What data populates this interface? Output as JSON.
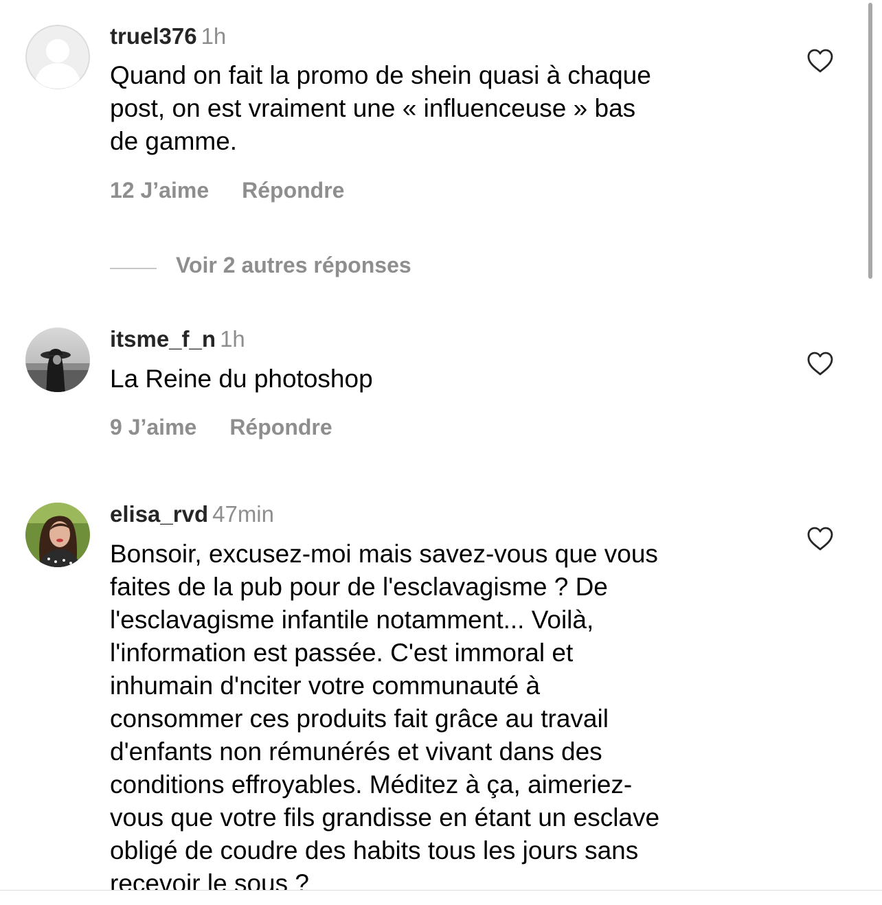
{
  "comments": [
    {
      "username": "truel376",
      "time": "1h",
      "avatar": "default-avatar-icon",
      "lines": [
        "Quand on fait la promo de shein quasi à chaque",
        "post, on est vraiment une « influenceuse » bas",
        "de gamme."
      ],
      "likes": "12 J’aime",
      "reply": "Répondre",
      "more_replies": "Voir 2 autres réponses"
    },
    {
      "username": "itsme_f_n",
      "time": "1h",
      "avatar": "profile-photo",
      "lines": [
        "La Reine du photoshop"
      ],
      "likes": "9 J’aime",
      "reply": "Répondre"
    },
    {
      "username": "elisa_rvd",
      "time": "47min",
      "avatar": "profile-photo",
      "lines": [
        "Bonsoir, excusez-moi mais savez-vous que vous",
        "faites de la pub pour de l'esclavagisme ? De",
        "l'esclavagisme infantile notamment... Voilà,",
        "l'information est passée. C'est immoral et",
        "inhumain d'nciter votre communauté à",
        "consommer ces produits fait grâce au travail",
        "d'enfants non rémunérés et vivant dans des",
        "conditions effroyables. Méditez à ça, aimeriez-",
        "vous que votre fils grandisse en étant un esclave",
        "obligé de coudre des habits tous les jours sans",
        "recevoir le sous ?"
      ]
    }
  ],
  "colors": {
    "text": "#000000",
    "username": "#262626",
    "secondary": "#8e8e8e",
    "divider": "#dbdbdb"
  }
}
